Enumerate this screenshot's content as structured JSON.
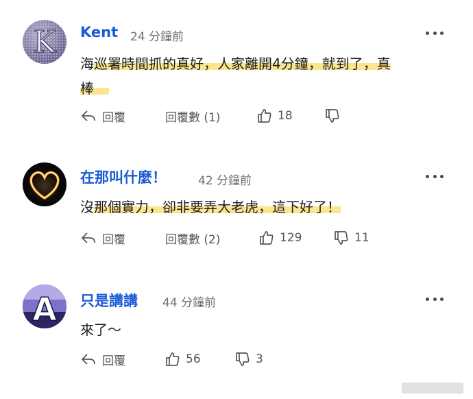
{
  "comments": [
    {
      "username": "Kent",
      "time": "24 分鐘前",
      "avatar_letter": "K",
      "text_line1_a": "海",
      "text_line1_b": "巡署時間抓的真好，人家離開4分鐘，就到了，真",
      "text_line2": "棒",
      "reply_label": "回覆",
      "view_replies_label": "回覆數 (1)",
      "likes": "18",
      "dislikes": ""
    },
    {
      "username": "在那叫什麼！",
      "time": "42 分鐘前",
      "text_a": "沒",
      "text_b": "那個實力，卻非要弄大老虎，這下好了！",
      "reply_label": "回覆",
      "view_replies_label": "回覆數 (2)",
      "likes": "129",
      "dislikes": "11"
    },
    {
      "username": "只是講講",
      "time": "44 分鐘前",
      "avatar_letter": "A",
      "text": "來了～",
      "reply_label": "回覆",
      "likes": "56",
      "dislikes": "3"
    }
  ],
  "colors": {
    "username": "#1a5bd6",
    "highlight": "#fbe58d",
    "meta": "#6e6e73"
  },
  "icons": [
    "reply-icon",
    "thumbs-up-icon",
    "thumbs-down-icon",
    "more-options-icon"
  ]
}
